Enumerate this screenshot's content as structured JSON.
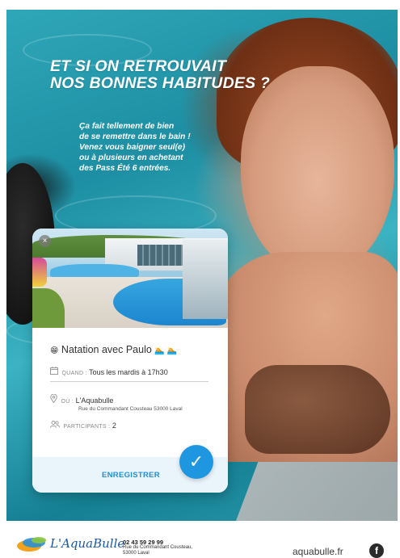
{
  "poster": {
    "headline_lines": [
      "ET SI ON RETROUVAIT",
      "NOS BONNES HABITUDES ?"
    ],
    "subtext_lines": [
      "Ça fait tellement de bien",
      "de se remettre dans le bain !",
      "Venez vous baigner seul(e)",
      "ou à plusieurs en achetant",
      "des Pass Été 6 entrées."
    ]
  },
  "card": {
    "close_glyph": "×",
    "title": "Natation avec Paulo",
    "title_emoji_prefix": "😁",
    "title_emoji_suffix": "🏊 🏊",
    "when": {
      "label": "QUAND :",
      "value": "Tous les mardis à 17h30"
    },
    "where": {
      "label": "OÙ :",
      "value": "L'Aquabulle",
      "address": "Rue du Commandant Cousteau 53000 Laval"
    },
    "participants": {
      "label": "PARTICIPANTS :",
      "value": "2"
    },
    "register_label": "ENREGISTRER",
    "check_glyph": "✓"
  },
  "footer": {
    "logo_text": "L'AquaBulle",
    "phone": "02 43 59 29 99",
    "address_lines": [
      "Rue du Commandant Cousteau,",
      "53000 Laval"
    ],
    "site": "aquabulle.fr",
    "facebook_glyph": "f"
  },
  "colors": {
    "accent": "#1f96e0",
    "logo_blue": "#1a5aa8"
  }
}
